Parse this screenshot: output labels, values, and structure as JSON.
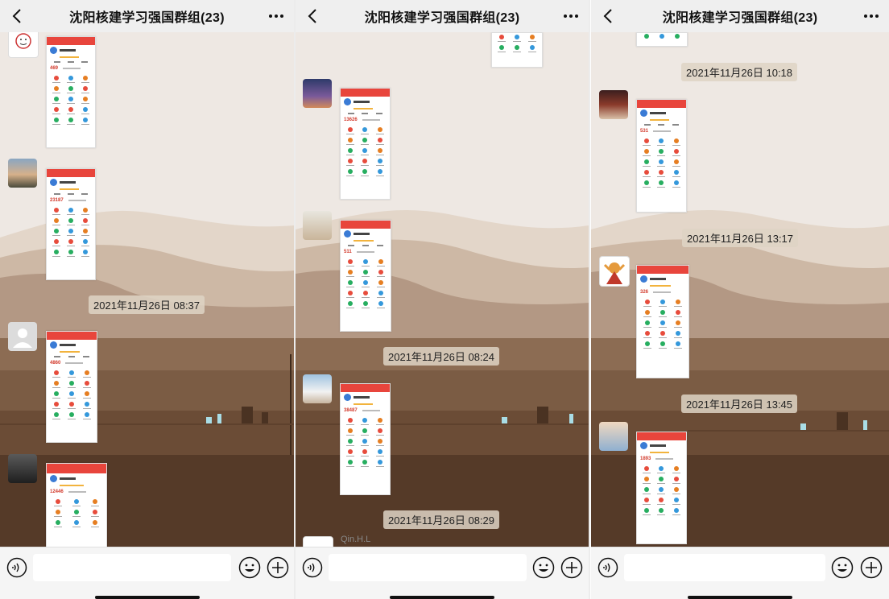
{
  "panels": [
    {
      "title": "沈阳核建学习强国群组(23)",
      "timestamps": [
        "2021年11月26日 08:37"
      ],
      "messages": [
        {
          "score": "469"
        },
        {
          "score": "23187"
        },
        {
          "score": "4860"
        },
        {
          "score": "12446"
        }
      ]
    },
    {
      "title": "沈阳核建学习强国群组(23)",
      "timestamps": [
        "2021年11月26日 08:24",
        "2021年11月26日 08:29"
      ],
      "sender": "Qin.H.L",
      "messages": [
        {
          "score": ""
        },
        {
          "score": "13626"
        },
        {
          "score": "511"
        },
        {
          "score": "38487"
        }
      ]
    },
    {
      "title": "沈阳核建学习强国群组(23)",
      "timestamps": [
        "2021年11月26日 10:18",
        "2021年11月26日 13:17",
        "2021年11月26日 13:45"
      ],
      "messages": [
        {
          "score": ""
        },
        {
          "score": "531"
        },
        {
          "score": "326"
        },
        {
          "score": "1893"
        }
      ]
    }
  ],
  "icons": {
    "back": "chevron-left-icon",
    "more": "more-dots-icon",
    "voice": "voice-icon",
    "emoji": "emoji-icon",
    "plus": "plus-circle-icon"
  },
  "colors": {
    "header_bg": "#efefef",
    "app_red": "#e8453c",
    "score_red": "#d23a2c",
    "stamp_bg": "#ded4c4",
    "input_bg": "#f5f5f5"
  }
}
